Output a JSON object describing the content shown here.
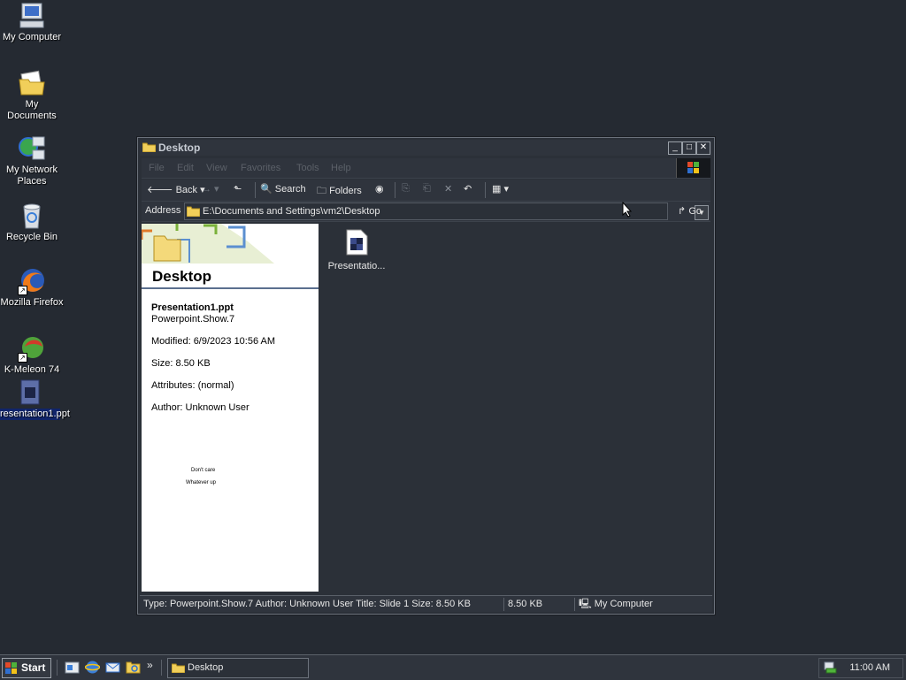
{
  "desktop": {
    "icons": [
      {
        "label": "My Computer",
        "icon": "computer-icon"
      },
      {
        "label": "My Documents",
        "icon": "documents-folder-icon"
      },
      {
        "label": "My Network Places",
        "icon": "network-icon"
      },
      {
        "label": "Recycle Bin",
        "icon": "recycle-bin-icon"
      },
      {
        "label": "Mozilla Firefox",
        "icon": "firefox-icon"
      },
      {
        "label": "K-Meleon 74",
        "icon": "kmeleon-icon"
      },
      {
        "label": "resentation1.ppt",
        "icon": "ppt-file-icon",
        "selected": true
      }
    ]
  },
  "window": {
    "title": "Desktop",
    "menu": [
      "File",
      "Edit",
      "View",
      "Favorites",
      "Tools",
      "Help"
    ],
    "toolbar": {
      "back_label": "Back",
      "search_label": "Search",
      "folders_label": "Folders"
    },
    "address": {
      "label": "Address",
      "path": "E:\\Documents and Settings\\vm2\\Desktop",
      "go_label": "Go"
    },
    "task_pane": {
      "title": "Desktop",
      "file_name": "Presentation1.ppt",
      "file_type": "Powerpoint.Show.7",
      "modified": "Modified: 6/9/2023 10:56 AM",
      "size": "Size: 8.50 KB",
      "attributes": "Attributes: (normal)",
      "author": "Author: Unknown User",
      "preview_line1": "Don't care",
      "preview_line2": "Whatever up"
    },
    "files": [
      {
        "label": "Presentatio...",
        "icon": "ppt-file-icon"
      }
    ],
    "status": {
      "details": "Type: Powerpoint.Show.7 Author: Unknown User Title: Slide 1 Size: 8.50 KB",
      "size": "8.50 KB",
      "zone": "My Computer"
    }
  },
  "taskbar": {
    "start_label": "Start",
    "task_label": "Desktop",
    "clock": "11:00 AM"
  }
}
